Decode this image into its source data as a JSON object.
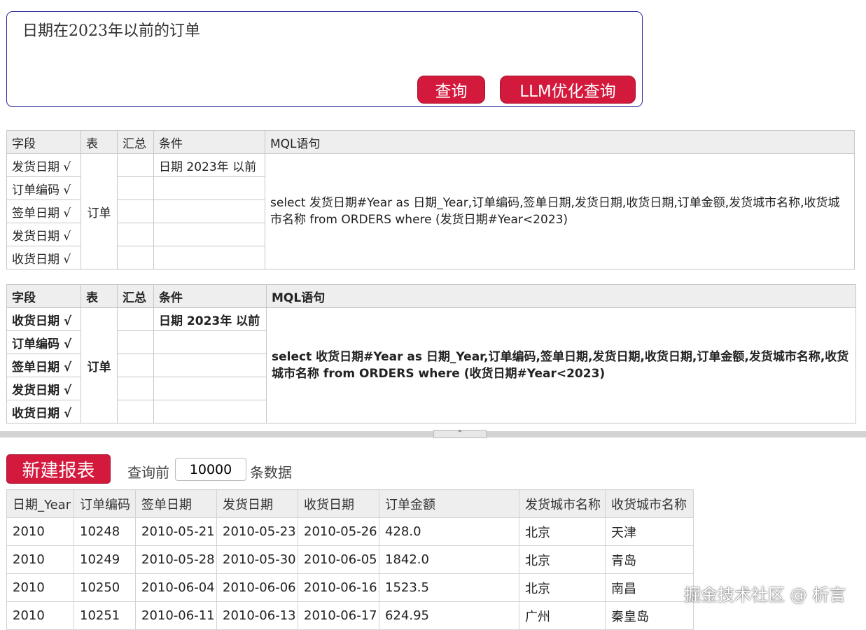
{
  "query": {
    "text": "日期在2023年以前的订单",
    "search_button": "查询",
    "llm_button": "LLM优化查询"
  },
  "mql_tables": [
    {
      "headers": [
        "字段",
        "表",
        "汇总",
        "条件",
        "MQL语句"
      ],
      "rows": [
        {
          "field": "发货日期 √",
          "condition": "日期 2023年 以前"
        },
        {
          "field": "订单编码 √",
          "condition": ""
        },
        {
          "field": "签单日期 √",
          "condition": ""
        },
        {
          "field": "发货日期 √",
          "condition": ""
        },
        {
          "field": "收货日期 √",
          "condition": ""
        }
      ],
      "table": "订单",
      "mql": "select 发货日期#Year as 日期_Year,订单编码,签单日期,发货日期,收货日期,订单金额,发货城市名称,收货城市名称 from ORDERS where (发货日期#Year<2023)"
    },
    {
      "headers": [
        "字段",
        "表",
        "汇总",
        "条件",
        "MQL语句"
      ],
      "rows": [
        {
          "field": "收货日期 √",
          "condition": "日期 2023年 以前"
        },
        {
          "field": "订单编码 √",
          "condition": ""
        },
        {
          "field": "签单日期 √",
          "condition": ""
        },
        {
          "field": "发货日期 √",
          "condition": ""
        },
        {
          "field": "收货日期 √",
          "condition": ""
        }
      ],
      "table": "订单",
      "mql": "select 收货日期#Year as 日期_Year,订单编码,签单日期,发货日期,收货日期,订单金额,发货城市名称,收货城市名称 from ORDERS where (收货日期#Year<2023)"
    }
  ],
  "splitter": {
    "icon": "chevron-up-icon",
    "glyph": "⌃"
  },
  "report": {
    "new_button": "新建报表",
    "limit_prefix": "查询前",
    "limit_value": "10000",
    "limit_suffix": "条数据"
  },
  "result": {
    "columns": [
      "日期_Year",
      "订单编码",
      "签单日期",
      "发货日期",
      "收货日期",
      "订单金额",
      "发货城市名称",
      "收货城市名称"
    ],
    "rows": [
      [
        "2010",
        "10248",
        "2010-05-21",
        "2010-05-23",
        "2010-05-26",
        "428.0",
        "北京",
        "天津"
      ],
      [
        "2010",
        "10249",
        "2010-05-28",
        "2010-05-30",
        "2010-06-05",
        "1842.0",
        "北京",
        "青岛"
      ],
      [
        "2010",
        "10250",
        "2010-06-04",
        "2010-06-06",
        "2010-06-16",
        "1523.5",
        "北京",
        "南昌"
      ],
      [
        "2010",
        "10251",
        "2010-06-11",
        "2010-06-13",
        "2010-06-17",
        "624.95",
        "广州",
        "秦皇岛"
      ]
    ]
  },
  "watermark": "掘金技术社区 @ 析言",
  "colors": {
    "accent": "#d31a3d",
    "query_border": "#2a2a9c",
    "header_bg": "#eeeeee"
  }
}
